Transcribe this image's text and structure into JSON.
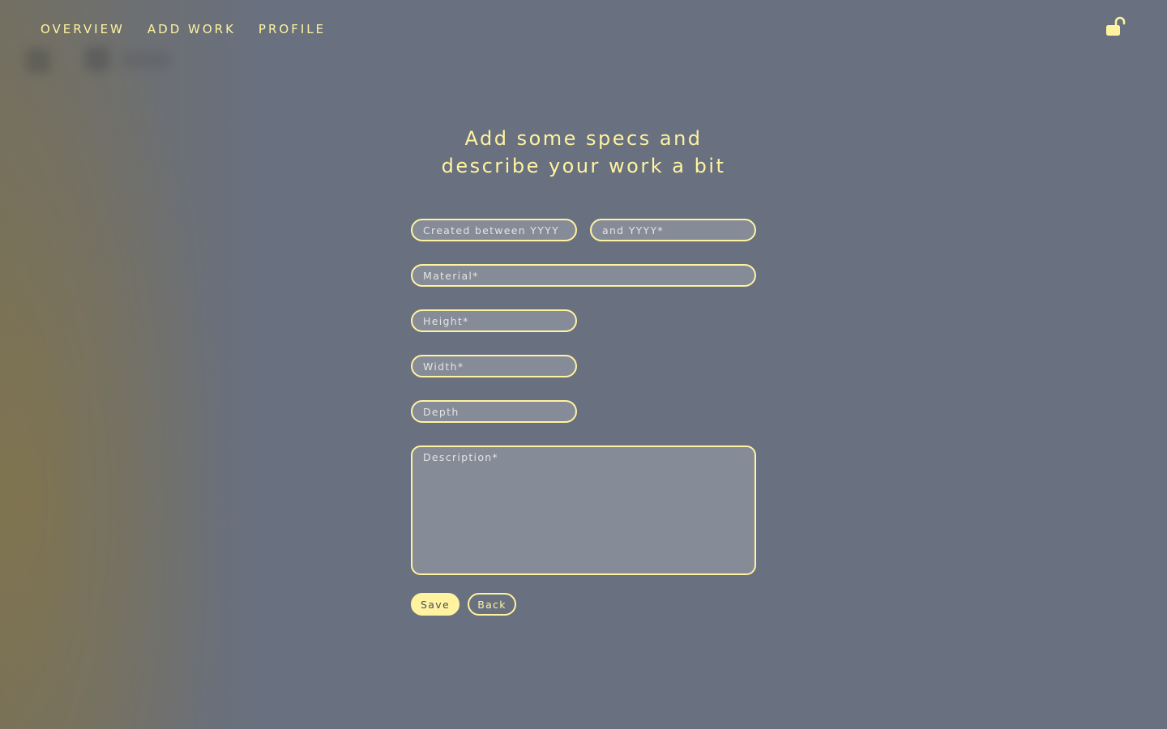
{
  "nav": {
    "items": [
      {
        "label": "OVERVIEW"
      },
      {
        "label": "ADD WORK"
      },
      {
        "label": "PROFILE"
      }
    ]
  },
  "header": {
    "lock_icon": "unlocked-padlock-icon"
  },
  "form": {
    "title_line1": "Add some specs and",
    "title_line2": "describe your work a bit",
    "created_from_placeholder": "Created between YYYY",
    "created_to_placeholder": "and YYYY*",
    "material_placeholder": "Material*",
    "height_placeholder": "Height*",
    "width_placeholder": "Width*",
    "depth_placeholder": "Depth",
    "description_placeholder": "Description*",
    "save_label": "Save",
    "back_label": "Back"
  },
  "colors": {
    "accent": "#fff3a0",
    "background": "#69707f",
    "field_fill": "#868b98"
  }
}
